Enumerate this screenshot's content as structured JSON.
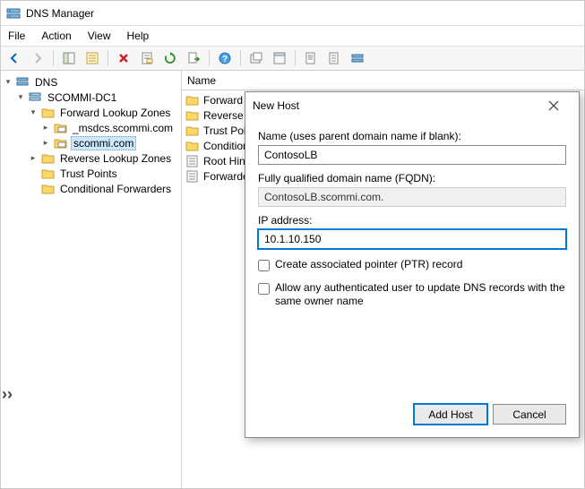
{
  "title": "DNS Manager",
  "menu": {
    "file": "File",
    "action": "Action",
    "view": "View",
    "help": "Help"
  },
  "tree": {
    "root": "DNS",
    "server": "SCOMMI-DC1",
    "flz": "Forward Lookup Zones",
    "msdcs": "_msdcs.scommi.com",
    "scommi": "scommi.com",
    "rlz": "Reverse Lookup Zones",
    "tp": "Trust Points",
    "cf": "Conditional Forwarders"
  },
  "list": {
    "header": "Name",
    "items": [
      "Forward L",
      "Reverse L",
      "Trust Poin",
      "Condition",
      "Root Hint",
      "Forwarder"
    ]
  },
  "dialog": {
    "title": "New Host",
    "name_label": "Name (uses parent domain name if blank):",
    "name_value": "ContosoLB",
    "fqdn_label": "Fully qualified domain name (FQDN):",
    "fqdn_value": "ContosoLB.scommi.com.",
    "ip_label": "IP address:",
    "ip_value": "10.1.10.150",
    "chk_ptr": "Create associated pointer (PTR) record",
    "chk_allow": "Allow any authenticated user to update DNS records with the same owner name",
    "btn_add": "Add Host",
    "btn_cancel": "Cancel"
  }
}
